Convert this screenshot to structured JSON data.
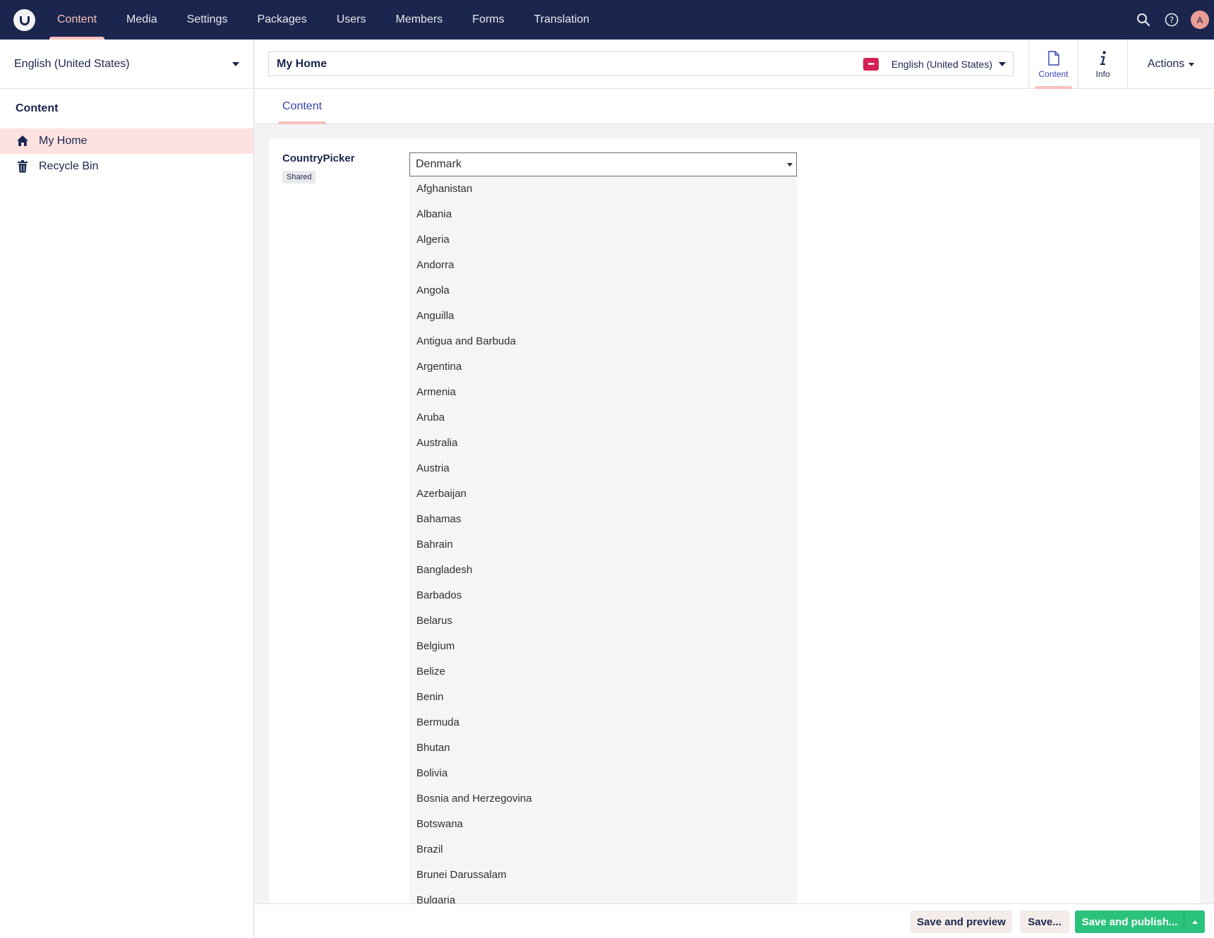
{
  "topbar": {
    "nav": [
      "Content",
      "Media",
      "Settings",
      "Packages",
      "Users",
      "Members",
      "Forms",
      "Translation"
    ],
    "active_nav": "Content",
    "avatar_initial": "A",
    "icons": [
      "search-icon",
      "help-icon"
    ]
  },
  "sidebar": {
    "language": "English (United States)",
    "tree_title": "Content",
    "items": [
      {
        "label": "My Home",
        "icon": "home-icon",
        "active": true
      },
      {
        "label": "Recycle Bin",
        "icon": "trash-icon",
        "active": false
      }
    ]
  },
  "editor": {
    "name_value": "My Home",
    "badge_text": "•••",
    "variant": "English (United States)",
    "apps": [
      {
        "label": "Content",
        "icon": "document-icon"
      },
      {
        "label": "Info",
        "icon": "info-icon"
      }
    ],
    "actions_label": "Actions"
  },
  "tabs": {
    "content_label": "Content"
  },
  "property": {
    "label": "CountryPicker",
    "badge": "Shared",
    "selected": "Denmark",
    "options": [
      "Afghanistan",
      "Albania",
      "Algeria",
      "Andorra",
      "Angola",
      "Anguilla",
      "Antigua and Barbuda",
      "Argentina",
      "Armenia",
      "Aruba",
      "Australia",
      "Austria",
      "Azerbaijan",
      "Bahamas",
      "Bahrain",
      "Bangladesh",
      "Barbados",
      "Belarus",
      "Belgium",
      "Belize",
      "Benin",
      "Bermuda",
      "Bhutan",
      "Bolivia",
      "Bosnia and Herzegovina",
      "Botswana",
      "Brazil",
      "Brunei Darussalam",
      "Bulgaria"
    ]
  },
  "footer": {
    "save_preview": "Save and preview",
    "save": "Save...",
    "save_publish": "Save and publish..."
  },
  "colors": {
    "topbar_bg": "#1b264f",
    "active_accent": "#f5c1bc",
    "publish_green": "#2bc37c"
  }
}
